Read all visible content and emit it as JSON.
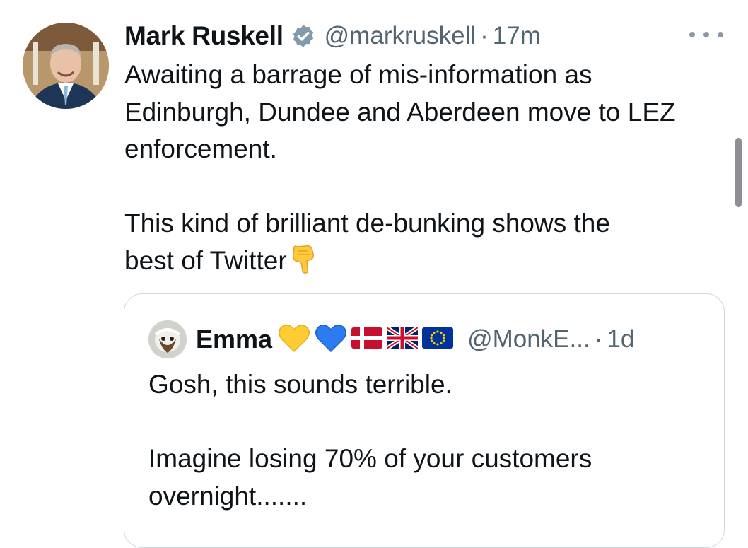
{
  "tweet": {
    "author_name": "Mark Ruskell",
    "handle": "@markruskell",
    "separator": "·",
    "time": "17m",
    "text": "Awaiting a barrage of mis-information as\nEdinburgh, Dundee and Aberdeen move to LEZ\nenforcement.\n\nThis kind of brilliant de-bunking shows the\nbest of Twitter",
    "trailing_emoji": "pointing-down-hand-icon",
    "verified": true
  },
  "quoted_tweet": {
    "author_name": "Emma",
    "name_emojis": [
      "yellow-heart-icon",
      "blue-heart-icon",
      "denmark-flag-icon",
      "uk-flag-icon",
      "eu-flag-icon"
    ],
    "handle": "@MonkE...",
    "separator": "·",
    "time": "1d",
    "text": "Gosh, this sounds terrible.\n\nImagine losing 70% of your customers\novernight......."
  },
  "colors": {
    "text": "#0f1419",
    "secondary": "#536471",
    "verified_badge": "#829aab",
    "border": "#cfd9de"
  }
}
